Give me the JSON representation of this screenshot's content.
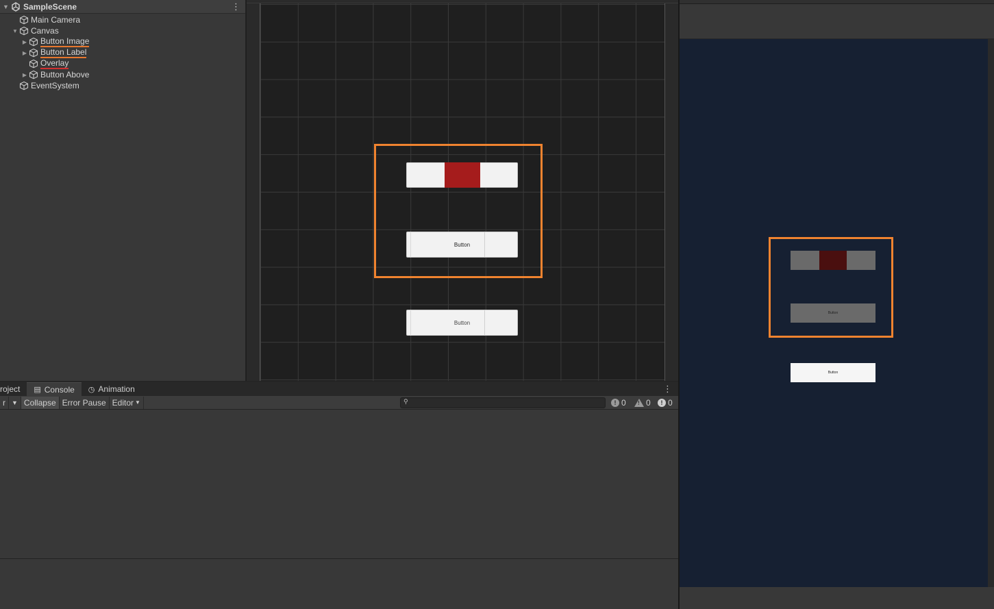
{
  "hierarchy": {
    "scene_name": "SampleScene",
    "items": [
      {
        "label": "Main Camera",
        "depth": 1,
        "expandable": false
      },
      {
        "label": "Canvas",
        "depth": 1,
        "expandable": true,
        "expanded": true
      },
      {
        "label": "Button Image",
        "depth": 2,
        "expandable": true,
        "underline": "orange"
      },
      {
        "label": "Button Label",
        "depth": 2,
        "expandable": true,
        "underline": "orange"
      },
      {
        "label": "Overlay",
        "depth": 2,
        "expandable": false,
        "underline": "red"
      },
      {
        "label": "Button Above",
        "depth": 2,
        "expandable": true
      },
      {
        "label": "EventSystem",
        "depth": 1,
        "expandable": false
      }
    ]
  },
  "scene": {
    "button_label_1": "Button",
    "button_label_2": "Button",
    "highlight_color": "#f0832f",
    "overlay_color": "#a51c1c"
  },
  "game": {
    "button_label_1": "Button",
    "button_label_2": "Button",
    "background_color": "#162032",
    "overlay_color": "#4a0f0f"
  },
  "console": {
    "tabs": [
      {
        "label": "roject",
        "icon": "folder-icon"
      },
      {
        "label": "Console",
        "icon": "console-icon",
        "active": true
      },
      {
        "label": "Animation",
        "icon": "animation-icon"
      }
    ],
    "toolbar": {
      "clear_dropdown": "r",
      "collapse": "Collapse",
      "error_pause": "Error Pause",
      "editor": "Editor"
    },
    "search_placeholder": "",
    "counts": {
      "errors": "0",
      "warnings": "0",
      "messages": "0"
    }
  }
}
